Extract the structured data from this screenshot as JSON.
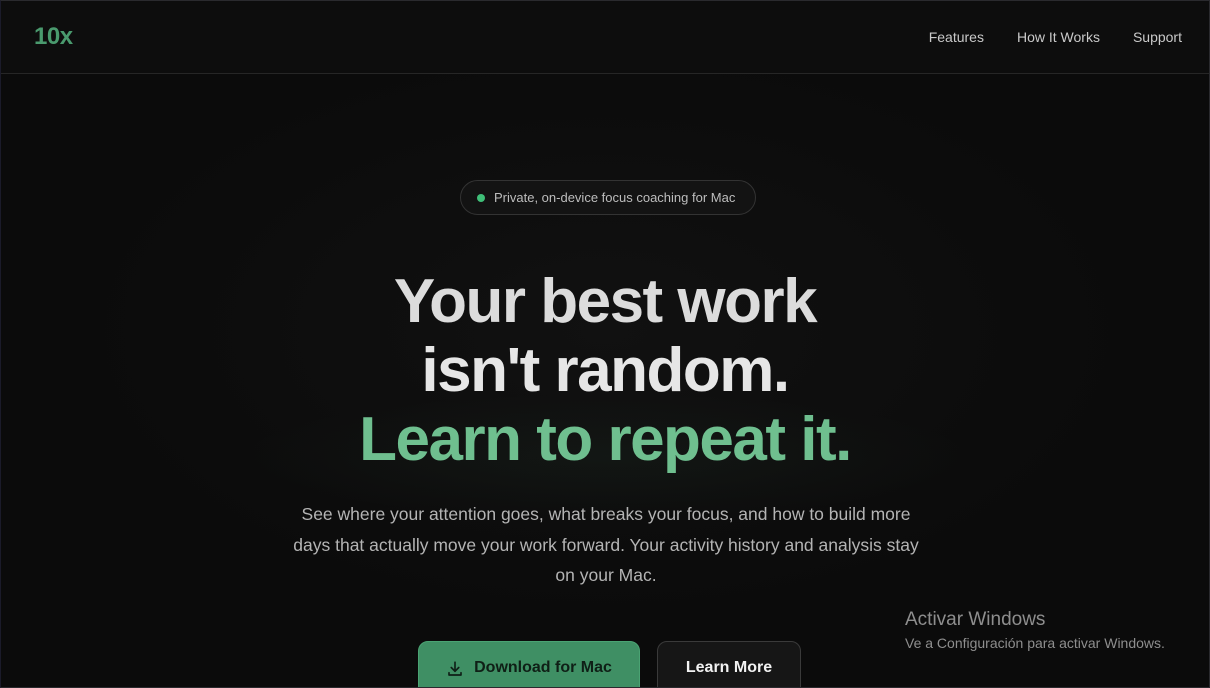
{
  "nav": {
    "logo": "10x",
    "links": [
      "Features",
      "How It Works",
      "Support"
    ]
  },
  "hero": {
    "badge": "Private, on-device focus coaching for Mac",
    "headline_line1": "Your best work",
    "headline_line2": "isn't random.",
    "headline_line3": "Learn to repeat it.",
    "subtext": "See where your attention goes, what breaks your focus, and how to build more days that actually move your work forward. Your activity history and analysis stay on your Mac.",
    "primary_button": "Download for Mac",
    "primary_button_icon": "download-icon",
    "secondary_button": "Learn More"
  },
  "watermark": {
    "title": "Activar Windows",
    "subtitle": "Ve a Configuración para activar Windows."
  },
  "colors": {
    "background": "#0b0b0b",
    "accent": "#4a9a6e",
    "headline_accent": "#6fbf8f",
    "primary_button": "#3f8f64",
    "badge_dot": "#3fbf78"
  }
}
